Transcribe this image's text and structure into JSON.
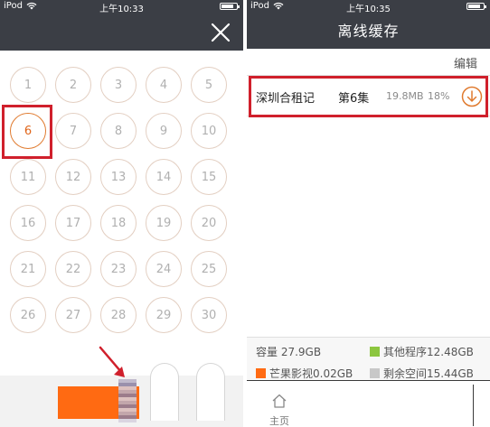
{
  "left_screen": {
    "status": {
      "carrier": "iPod",
      "time": "上午10:33"
    },
    "close_icon": "close-icon",
    "episodes": [
      "1",
      "2",
      "3",
      "4",
      "5",
      "6",
      "7",
      "8",
      "9",
      "10",
      "11",
      "12",
      "13",
      "14",
      "15",
      "16",
      "17",
      "18",
      "19",
      "20",
      "21",
      "22",
      "23",
      "24",
      "25",
      "26",
      "27",
      "28",
      "29",
      "30"
    ],
    "selected_episode": "6",
    "colors": {
      "accent": "#ff6a12",
      "bar": "#3b3e45",
      "highlight": "#d0202c"
    }
  },
  "right_screen": {
    "status": {
      "carrier": "iPod",
      "time": "上午10:35"
    },
    "title": "离线缓存",
    "edit_label": "编辑",
    "item": {
      "title": "深圳合租记",
      "episode": "第6集",
      "size": "19.8MB",
      "percent": "18%",
      "icon": "download-icon"
    },
    "storage": {
      "total": "容量 27.9GB",
      "other": "其他程序12.48GB",
      "mango": "芒果影视0.02GB",
      "free": "剩余空间15.44GB",
      "colors": {
        "other": "#8cc63f",
        "mango": "#ff6a12",
        "free": "#c8c8c8"
      }
    },
    "tabs": {
      "home": "主页",
      "home_icon": "home-icon"
    }
  }
}
